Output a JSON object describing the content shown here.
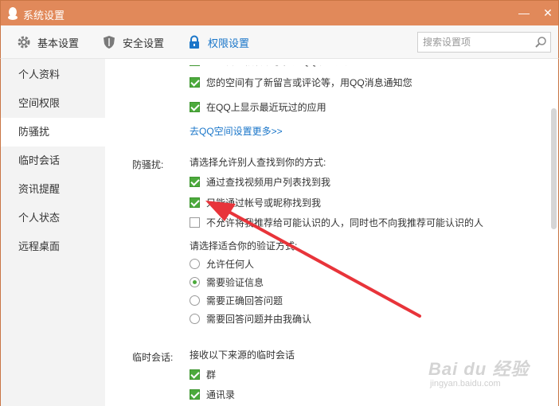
{
  "window": {
    "title": "系统设置",
    "min_symbol": "—",
    "close_symbol": "✕",
    "accent_color": "#e1895a"
  },
  "toolbar": {
    "tabs": [
      {
        "label": "基本设置",
        "icon": "gear-icon"
      },
      {
        "label": "安全设置",
        "icon": "shield-icon"
      },
      {
        "label": "权限设置",
        "icon": "lock-icon",
        "active": true
      }
    ],
    "search_placeholder": "搜索设置项"
  },
  "sidebar": {
    "items": [
      {
        "label": "个人资料"
      },
      {
        "label": "空间权限"
      },
      {
        "label": "防骚扰",
        "active": true
      },
      {
        "label": "临时会话"
      },
      {
        "label": "资讯提醒"
      },
      {
        "label": "个人状态"
      },
      {
        "label": "远程桌面"
      }
    ]
  },
  "content": {
    "space_options": [
      {
        "label": "您的日志被转载了，用QQ消息通知您",
        "checked": true
      },
      {
        "label": "您的空间有了新留言或评论等，用QQ消息通知您",
        "checked": true
      },
      {
        "label": "在QQ上显示最近玩过的应用",
        "checked": true
      }
    ],
    "space_more_link": "去QQ空间设置更多>>",
    "anti_harass": {
      "label": "防骚扰:",
      "find_prompt": "请选择允许别人查找到你的方式:",
      "find_options": [
        {
          "label": "通过查找视频用户列表找到我",
          "checked": true
        },
        {
          "label": "只能通过帐号或昵称找到我",
          "checked": true
        },
        {
          "label": "不允许将我推荐给可能认识的人，同时也不向我推荐可能认识的人",
          "checked": false
        }
      ],
      "verify_prompt": "请选择适合你的验证方式:",
      "verify_options": [
        {
          "label": "允许任何人",
          "checked": false
        },
        {
          "label": "需要验证信息",
          "checked": true
        },
        {
          "label": "需要正确回答问题",
          "checked": false
        },
        {
          "label": "需要回答问题并由我确认",
          "checked": false
        }
      ]
    },
    "temp_session": {
      "label": "临时会话:",
      "prompt": "接收以下来源的临时会话",
      "options": [
        {
          "label": "群",
          "checked": true
        },
        {
          "label": "通讯录",
          "checked": true
        }
      ]
    }
  },
  "watermark": {
    "main": "Bai du 经验",
    "sub": "jingyan.baidu.com"
  }
}
